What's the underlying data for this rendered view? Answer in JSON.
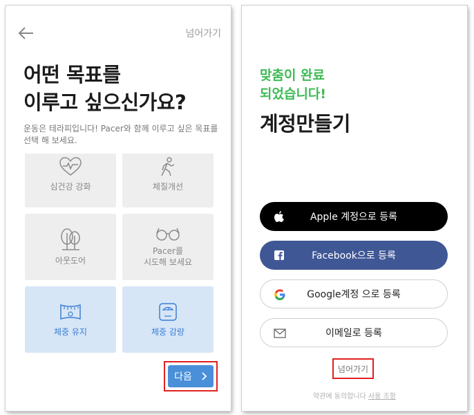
{
  "screen1": {
    "skip_label": "넘어가기",
    "title_line1": "어떤 목표를",
    "title_line2": "이루고 싶으신가요?",
    "description": "운동은 테라피입니다! Pacer와 함께 이루고 싶은 목표를 선택 해 보세요.",
    "goals": [
      {
        "label": "심건강 강화",
        "icon": "heart-pulse-icon",
        "selected": false
      },
      {
        "label": "체질개선",
        "icon": "walking-person-icon",
        "selected": false
      },
      {
        "label": "아웃도어",
        "icon": "tree-icon",
        "selected": false
      },
      {
        "label": "Pacer를\n시도해 보세요",
        "icon": "glasses-icon",
        "selected": false
      },
      {
        "label": "체중 유지",
        "icon": "measuring-tape-icon",
        "selected": true
      },
      {
        "label": "체중 감량",
        "icon": "scale-icon",
        "selected": true
      }
    ],
    "next_label": "다음",
    "next_icon": "chevron-right-icon"
  },
  "screen2": {
    "welcome_line1": "맞춤이 완료",
    "welcome_line2": "되었습니다!",
    "title": "계정만들기",
    "buttons": {
      "apple": "Apple 계정으로 등록",
      "facebook": "Facebook으로 등록",
      "google": "Google계정 으로 등록",
      "email": "이메일로 등록"
    },
    "skip_label": "넘어가기",
    "terms_prefix": "약관에 동의합니다",
    "terms_link": "사용 조항"
  },
  "colors": {
    "accent_blue": "#4a8fd9",
    "selected_tile": "#d6e6f7",
    "green": "#3dba55",
    "facebook": "#3f5795",
    "highlight_red": "#e02020"
  }
}
